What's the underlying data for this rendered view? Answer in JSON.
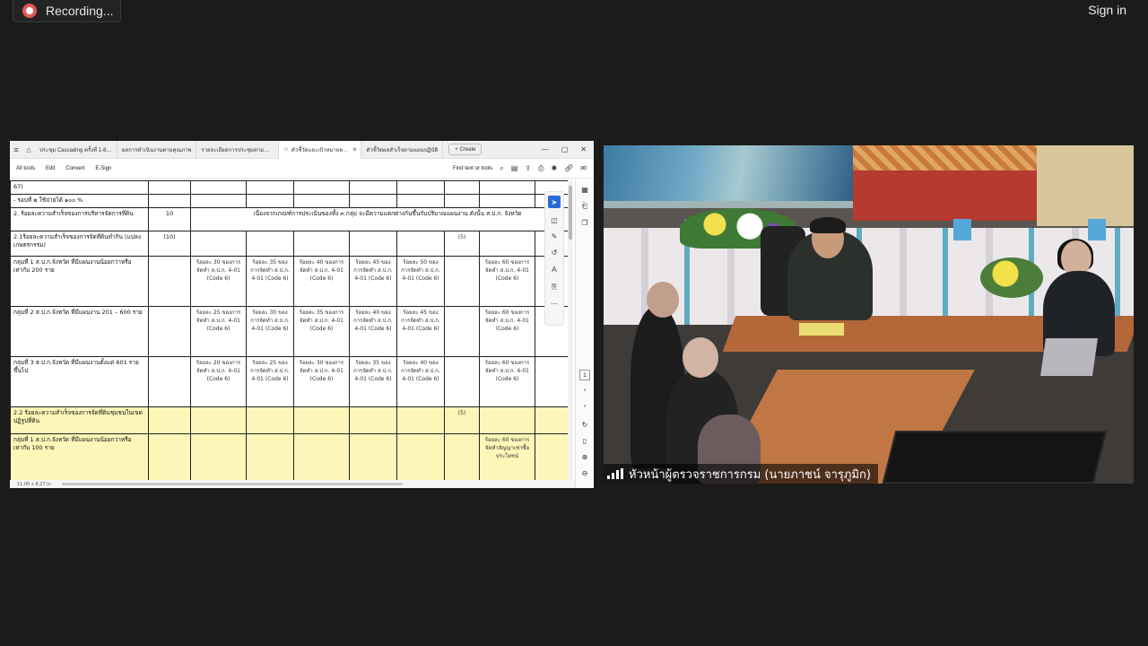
{
  "topbar": {
    "recording_label": "Recording...",
    "sign_in_label": "Sign in"
  },
  "pdf_viewer": {
    "tabs": [
      {
        "label": "ประชุม Cascading ครั้งที่ 1-8/ PPT"
      },
      {
        "label": "ผลการดำเนินงานตามคุณภาพ"
      },
      {
        "label": "รายละเอียดการประชุมตามลำดับ"
      },
      {
        "label": "ตัวชี้วัดและเป้าหมายตามแผน",
        "active": true
      },
      {
        "label": "ตัวชี้วัดผลสำเร็จตามแผนปฏิบัติ"
      }
    ],
    "create_label": "+ Create",
    "menu": [
      "All tools",
      "Edit",
      "Convert",
      "E-Sign"
    ],
    "find_label": "Find text or tools",
    "page_number": "1",
    "status_text": "11.00 x 8.27 in",
    "table_rows": [
      {
        "label": "67)",
        "weight": "",
        "cells": [
          "",
          "",
          "",
          "",
          "",
          "",
          ""
        ]
      },
      {
        "label": "- รอบที่ ๒ ใช้จ่ายได้ ๑๐๐ %",
        "weight": "",
        "cells": [
          "",
          "",
          "",
          "",
          "",
          "",
          ""
        ]
      },
      {
        "label": "2. ร้อยละความสำเร็จของการบริหารจัดการที่ดิน",
        "weight": "10",
        "merged": "เนื่องจากเกณฑ์การประเมินของทั้ง ๓ กลุ่ม จะมีความแตกต่างกันขึ้นกับปริมาณแผนงาน ดังนั้น ส.ป.ก. จังหวัด"
      },
      {
        "label": "2.1ร้อยละความสำเร็จของการจัดที่ดินทำกิน (แปลงเกษตรกรรม)",
        "weight": "(10)",
        "cells": [
          "",
          "",
          "",
          "",
          "",
          "(5)",
          ""
        ]
      },
      {
        "label": "กลุ่มที่ 1 ส.ป.ก.จังหวัด ที่มีแผนงานน้อยกว่าหรือเท่ากับ 200 ราย",
        "weight": "",
        "cells": [
          "ร้อยละ 30 ของการจัดทำ ส.ป.ก. 4-01 (Code 6)",
          "ร้อยละ 35 ของการจัดทำ ส.ป.ก. 4-01 (Code 6)",
          "ร้อยละ 40 ของการจัดทำ ส.ป.ก. 4-01 (Code 6)",
          "ร้อยละ 45 ของการจัดทำ ส.ป.ก. 4-01 (Code 6)",
          "ร้อยละ 50 ของการจัดทำ ส.ป.ก. 4-01 (Code 6)",
          "",
          "ร้อยละ 60 ของการจัดทำ ส.ป.ก. 4-01 (Code 6)"
        ]
      },
      {
        "label": "กลุ่มที่ 2 ส.ป.ก.จังหวัด ที่มีแผนงาน 201 – 600 ราย",
        "weight": "",
        "cells": [
          "ร้อยละ 25 ของการจัดทำ ส.ป.ก. 4-01 (Code 6)",
          "ร้อยละ 30 ของการจัดทำ ส.ป.ก. 4-01 (Code 6)",
          "ร้อยละ 35 ของการจัดทำ ส.ป.ก. 4-01 (Code 6)",
          "ร้อยละ 40 ของการจัดทำ ส.ป.ก. 4-01 (Code 6)",
          "ร้อยละ 45 ของการจัดทำ ส.ป.ก. 4-01 (Code 6)",
          "",
          "ร้อยละ 60 ของการจัดทำ ส.ป.ก. 4-01 (Code 6)"
        ]
      },
      {
        "label": "กลุ่มที่ 3 ส.ป.ก.จังหวัด ที่มีแผนงานตั้งแต่ 601 ราย ขึ้นไป",
        "weight": "",
        "cells": [
          "ร้อยละ 20 ของการจัดทำ ส.ป.ก. 4-01 (Code 6)",
          "ร้อยละ 25 ของการจัดทำ ส.ป.ก. 4-01 (Code 6)",
          "ร้อยละ 30 ของการจัดทำ ส.ป.ก. 4-01 (Code 6)",
          "ร้อยละ 35 ของการจัดทำ ส.ป.ก. 4-01 (Code 6)",
          "ร้อยละ 40 ของการจัดทำ ส.ป.ก. 4-01 (Code 6)",
          "",
          "ร้อยละ 60 ของการจัดทำ ส.ป.ก. 4-01 (Code 6)"
        ]
      },
      {
        "label": "2.2 ร้อยละความสำเร็จของการจัดที่ดินชุมชนในเขตปฏิรูปที่ดิน",
        "weight": "",
        "yellow": true,
        "cells": [
          "",
          "",
          "",
          "",
          "",
          "(5)",
          ""
        ]
      },
      {
        "label": "กลุ่มที่ 1 ส.ป.ก.จังหวัด ที่มีแผนงานน้อยกว่าหรือเท่ากับ 100 ราย",
        "weight": "",
        "yellow": true,
        "cells": [
          "",
          "",
          "",
          "",
          "",
          "",
          "ร้อยละ 60 ของการจัดทำสัญญาเช่าซื้อ ประโยชน์"
        ]
      }
    ]
  },
  "video": {
    "speaker_name": "หัวหน้าผู้ตรวจราชการกรม (นายภาชน์ จารุภูมิก)"
  }
}
